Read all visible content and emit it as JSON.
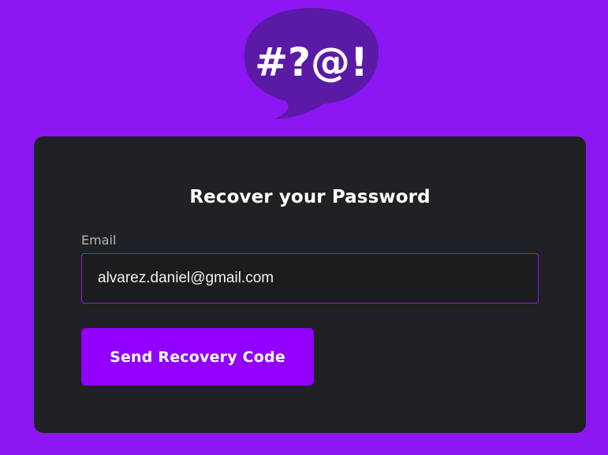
{
  "logo": {
    "text": "#?@!",
    "icon": "speech-bubble-icon",
    "bubble_color": "#5b1aa6"
  },
  "recover": {
    "title": "Recover your Password",
    "email_label": "Email",
    "email_value": "alvarez.daniel@gmail.com",
    "submit_label": "Send Recovery Code"
  },
  "colors": {
    "page_background": "#8c17f2",
    "card_background": "#202124",
    "accent": "#9200ff"
  }
}
